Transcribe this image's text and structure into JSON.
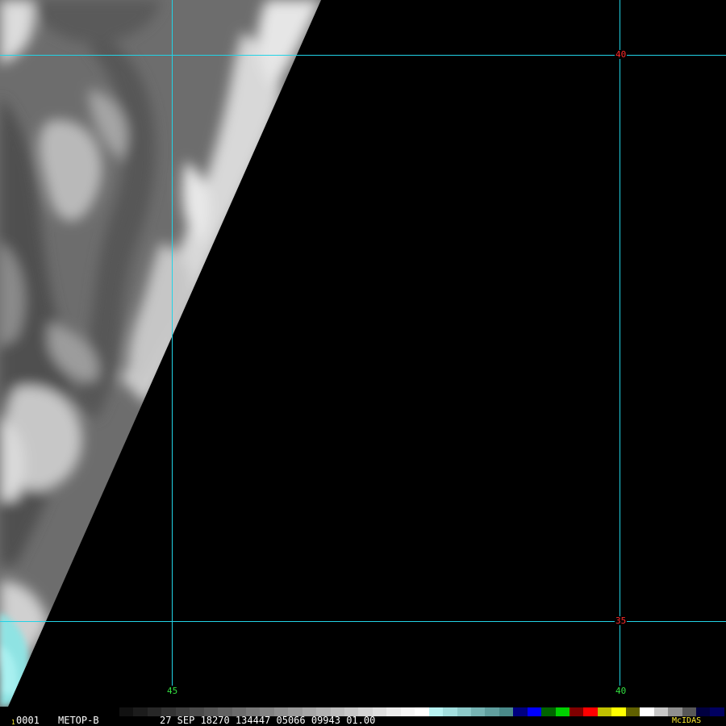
{
  "grid": {
    "latitudes": [
      {
        "value": "40",
        "color": "#ff2a2a"
      },
      {
        "value": "35",
        "color": "#ff2a2a"
      }
    ],
    "longitudes": [
      {
        "value": "45",
        "color": "#33e040"
      },
      {
        "value": "40",
        "color": "#33e040"
      }
    ],
    "line_color": "#22d3e6"
  },
  "status_bar": {
    "frame_marker": "1",
    "frame_number": "0001",
    "satellite": "METOP-B",
    "image_header": "27 SEP 18270 134447 05066 09943 01.00",
    "software": "McIDAS"
  },
  "colorbar": {
    "segments": [
      "#111111",
      "#1c1c1c",
      "#272727",
      "#333333",
      "#3e3e3e",
      "#4a4a4a",
      "#555555",
      "#616161",
      "#6c6c6c",
      "#787878",
      "#838383",
      "#8f8f8f",
      "#9a9a9a",
      "#a6a6a6",
      "#b1b1b1",
      "#bdbdbd",
      "#c8c8c8",
      "#d4d4d4",
      "#dfdfdf",
      "#ebebeb",
      "#f6f6f6",
      "#ffffff",
      "#b8f2f2",
      "#a2dede",
      "#8cc9c9",
      "#76b4b4",
      "#609f9f",
      "#4a8a8a",
      "#000080",
      "#0000ff",
      "#006400",
      "#00d000",
      "#800000",
      "#ff0000",
      "#c0c000",
      "#ffff00",
      "#606000",
      "#ffffff",
      "#c8c8c8",
      "#909090",
      "#585858",
      "#000040",
      "#000060"
    ]
  }
}
